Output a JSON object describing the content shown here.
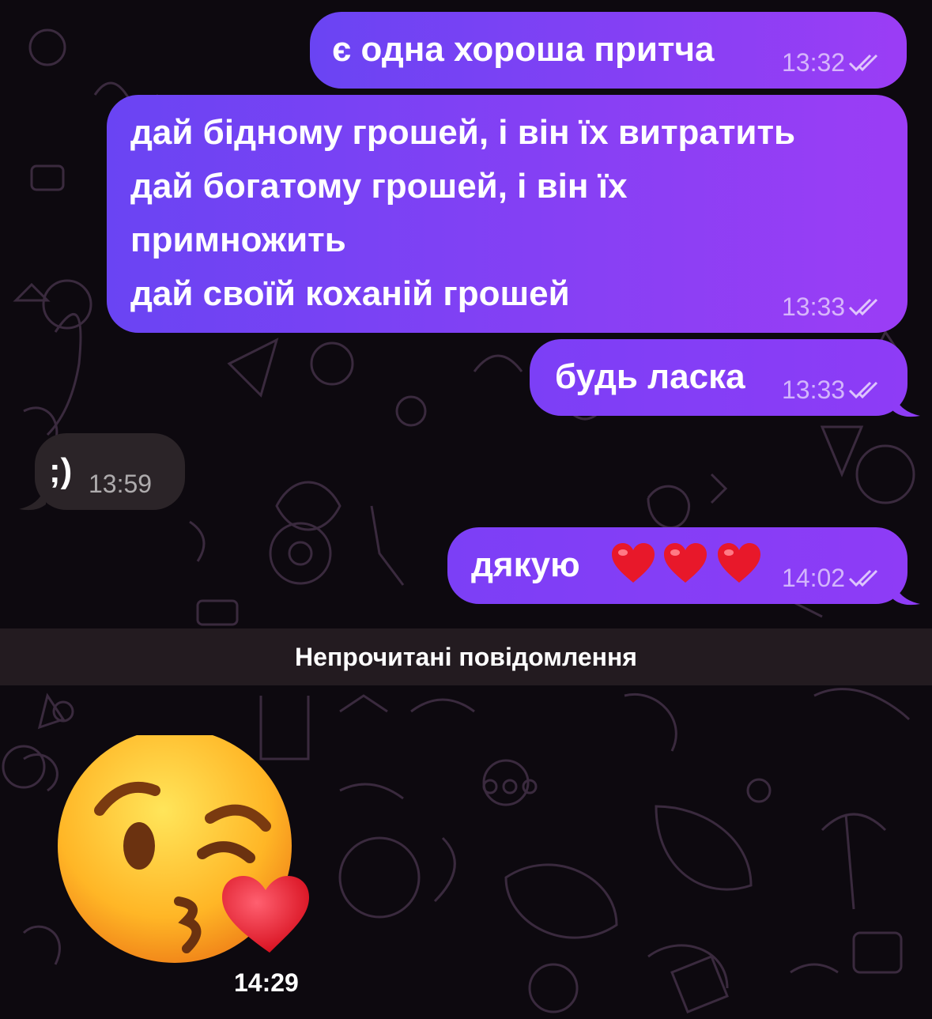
{
  "messages": [
    {
      "text": "є одна хороша притча",
      "time": "13:32"
    },
    {
      "lines": [
        "дай бідному грошей, і він їх витратить",
        "дай богатому грошей, і він їх",
        "примножить",
        "дай своїй коханій грошей"
      ],
      "time": "13:33"
    },
    {
      "text": "будь ласка",
      "time": "13:33"
    },
    {
      "text": ";)",
      "time": "13:59"
    },
    {
      "text": "дякую",
      "emoji": "red-heart x3",
      "time": "14:02"
    }
  ],
  "separator": {
    "label": "Непрочитані повідомлення"
  },
  "sticker": {
    "emoji": "face-blowing-a-kiss",
    "time": "14:29"
  },
  "colors": {
    "outgoing_start": "#6a44f3",
    "outgoing_end": "#9b3df5",
    "incoming": "#2b2428",
    "background": "#0d090f",
    "separator": "#231b20"
  }
}
